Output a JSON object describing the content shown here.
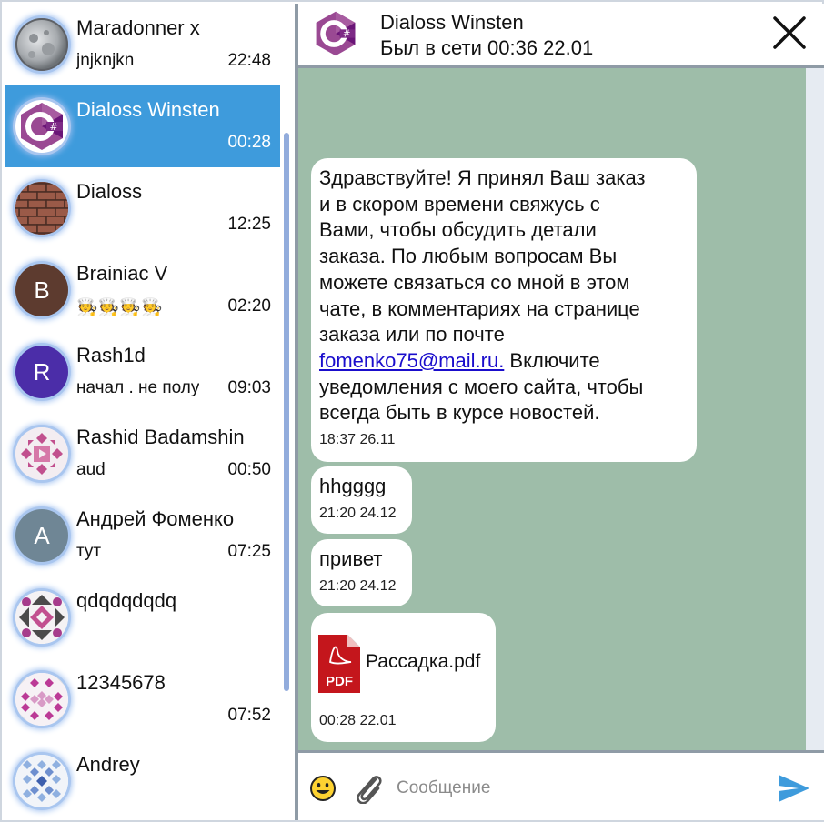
{
  "sidebar": {
    "chats": [
      {
        "name": "Maradonner x",
        "preview": "jnjknjkn",
        "time": "22:48",
        "avatar": "moon-photo"
      },
      {
        "name": "Dialoss Winsten",
        "preview": "",
        "time": "00:28",
        "avatar": "csharp-logo",
        "active": true
      },
      {
        "name": "Dialoss",
        "preview": "",
        "time": "12:25",
        "avatar": "brick-wall-photo"
      },
      {
        "name": "Brainiac V",
        "preview": "🧑‍🍳🧑‍🍳🧑‍🍳🧑‍🍳",
        "time": "02:20",
        "avatar_letter": "B",
        "avatar_color": "#5d3b2f"
      },
      {
        "name": "Rash1d",
        "preview": "начал . не полу",
        "time": "09:03",
        "avatar_letter": "R",
        "avatar_color": "#4b2da8"
      },
      {
        "name": "Rashid Badamshin",
        "preview": "aud",
        "time": "00:50",
        "avatar": "identicon-pink"
      },
      {
        "name": "Андрей Фоменко",
        "preview": "тут",
        "time": "07:25",
        "avatar_letter": "A",
        "avatar_color": "#6f8695"
      },
      {
        "name": "qdqdqdqdq",
        "preview": "",
        "time": "",
        "avatar": "identicon-purple-gray"
      },
      {
        "name": "12345678",
        "preview": "",
        "time": "07:52",
        "avatar": "identicon-magenta"
      },
      {
        "name": "Andrey",
        "preview": "",
        "time": "",
        "avatar": "identicon-blue"
      }
    ]
  },
  "header": {
    "name": "Dialoss Winsten",
    "status": "Был в сети 00:36 22.01"
  },
  "messages": [
    {
      "text_before": "Здравствуйте! Я принял Ваш заказ\nи в скором времени свяжусь с\nВами, чтобы обсудить детали\nзаказа. По любым вопросам Вы\nможете связаться со мной в этом\nчате, в комментариях на странице\nзаказа или по почте\n",
      "link": "fomenko75@mail.ru.",
      "text_after": " Включите\nуведомления с моего сайта, чтобы\nвсегда быть в курсе новостей.",
      "time": "18:37 26.11"
    },
    {
      "text": "hhgggg",
      "time": "21:20 24.12"
    },
    {
      "text": "привет",
      "time": "21:20 24.12"
    },
    {
      "file_name": "Рассадка.pdf",
      "file_icon": "pdf-icon",
      "file_badge": "PDF",
      "time": "00:28 22.01"
    }
  ],
  "composer": {
    "placeholder": "Сообщение",
    "emoji_icon": "emoji-icon",
    "attach_icon": "paperclip-icon",
    "send_icon": "send-icon"
  },
  "colors": {
    "active_chat": "#3e9bdc",
    "chat_background": "#9ebda9",
    "send_button": "#3e9bdc",
    "pdf_red": "#c4161c"
  }
}
